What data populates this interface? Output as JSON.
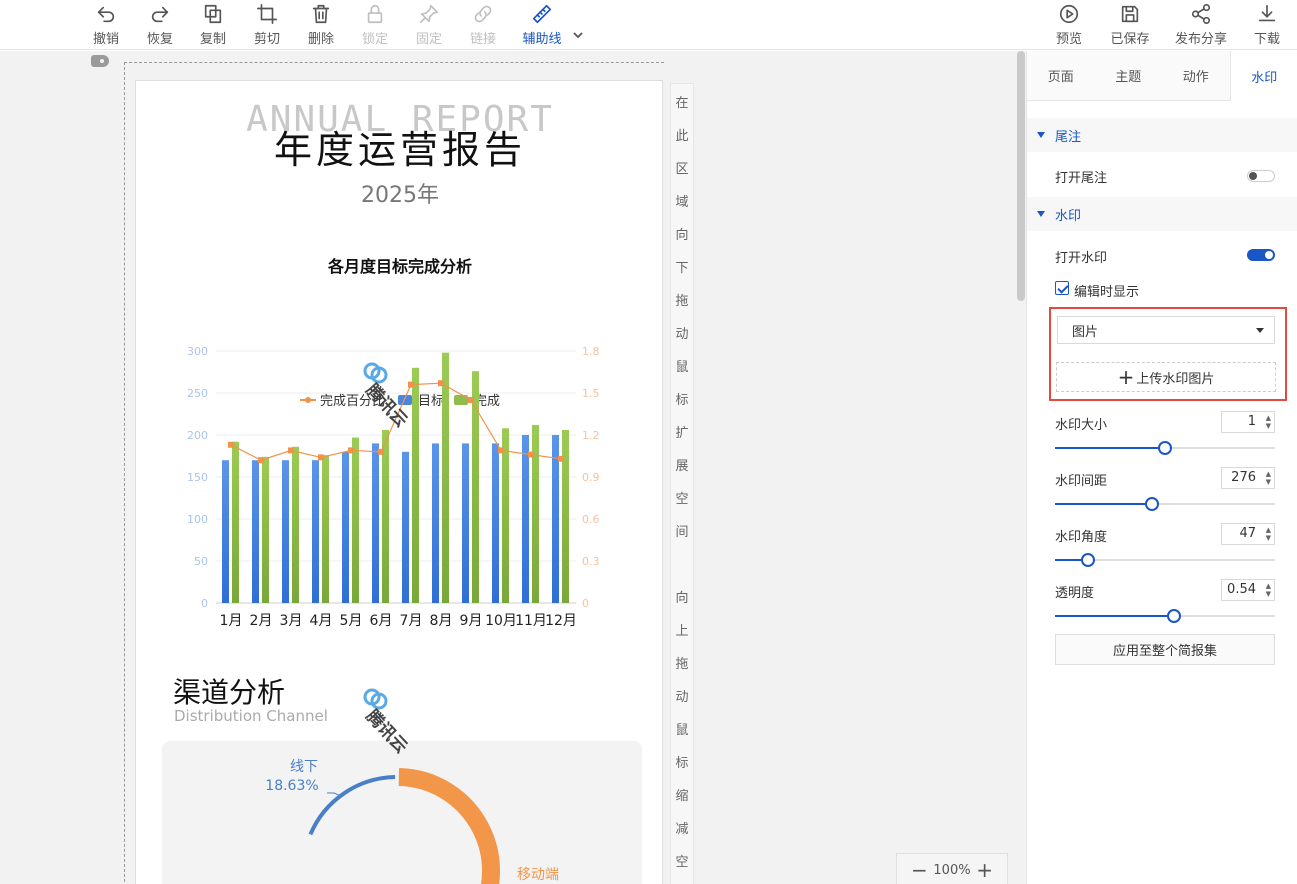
{
  "toolbar": {
    "left": [
      {
        "label": "撤销",
        "icon": "undo-icon",
        "state": "normal"
      },
      {
        "label": "恢复",
        "icon": "redo-icon",
        "state": "normal"
      },
      {
        "label": "复制",
        "icon": "copy-icon",
        "state": "normal"
      },
      {
        "label": "剪切",
        "icon": "crop-icon",
        "state": "normal"
      },
      {
        "label": "删除",
        "icon": "trash-icon",
        "state": "normal"
      },
      {
        "label": "锁定",
        "icon": "lock-icon",
        "state": "disabled"
      },
      {
        "label": "固定",
        "icon": "pin-icon",
        "state": "disabled"
      },
      {
        "label": "链接",
        "icon": "link-icon",
        "state": "disabled"
      },
      {
        "label": "辅助线",
        "icon": "ruler-icon",
        "state": "active"
      }
    ],
    "right": [
      {
        "label": "预览",
        "icon": "play-icon"
      },
      {
        "label": "已保存",
        "icon": "save-icon"
      },
      {
        "label": "发布分享",
        "icon": "share-icon"
      },
      {
        "label": "下载",
        "icon": "download-icon"
      }
    ]
  },
  "report": {
    "annual_text": "ANNUAL REPORT",
    "title": "年度运营报告",
    "year": "2025年",
    "chart_title": "各月度目标完成分析",
    "section_title": "渠道分析",
    "section_subtitle": "Distribution Channel",
    "watermark_text": "腾讯云"
  },
  "chart_data": [
    {
      "type": "bar",
      "title": "各月度目标完成分析",
      "categories": [
        "1月",
        "2月",
        "3月",
        "4月",
        "5月",
        "6月",
        "7月",
        "8月",
        "9月",
        "10月",
        "11月",
        "12月"
      ],
      "legend": [
        "完成百分比",
        "目标",
        "完成"
      ],
      "series": [
        {
          "name": "目标",
          "type": "bar",
          "axis": "left",
          "values": [
            170,
            170,
            170,
            170,
            180,
            190,
            180,
            190,
            190,
            190,
            200,
            200
          ]
        },
        {
          "name": "完成",
          "type": "bar",
          "axis": "left",
          "values": [
            192,
            174,
            186,
            176,
            197,
            206,
            280,
            298,
            276,
            208,
            212,
            206
          ]
        },
        {
          "name": "完成百分比",
          "type": "line",
          "axis": "right",
          "values": [
            1.13,
            1.02,
            1.09,
            1.04,
            1.09,
            1.08,
            1.56,
            1.57,
            1.45,
            1.09,
            1.06,
            1.03
          ]
        }
      ],
      "yleft_ticks": [
        "0",
        "50",
        "100",
        "150",
        "200",
        "250",
        "300"
      ],
      "yright_ticks": [
        "0",
        "0.3",
        "0.6",
        "0.9",
        "1.2",
        "1.5",
        "1.8"
      ],
      "ylim_left": [
        0,
        300
      ],
      "ylim_right": [
        0,
        1.8
      ],
      "colors": {
        "target": "#4a86e0",
        "done": "#8fbc4a",
        "pct": "#f2924a"
      }
    },
    {
      "type": "pie",
      "slices": [
        {
          "label": "线下",
          "value": 18.63,
          "value_text": "18.63%",
          "color": "#4a7fc8"
        },
        {
          "label": "移动端",
          "color": "#f2964a"
        }
      ]
    }
  ],
  "side_hint": {
    "down_chars": [
      "在",
      "此",
      "区",
      "域",
      "向",
      "下",
      "拖",
      "动",
      "鼠",
      "标",
      "扩",
      "展",
      "空",
      "间"
    ],
    "up_chars": [
      "向",
      "上",
      "拖",
      "动",
      "鼠",
      "标",
      "缩",
      "减",
      "空"
    ]
  },
  "zoom": {
    "value": "100%",
    "minus": "−",
    "plus": "+"
  },
  "panel": {
    "tabs": [
      "页面",
      "主题",
      "动作",
      "水印"
    ],
    "active_tab": "水印",
    "footnote_section": "尾注",
    "footnote_toggle_label": "打开尾注",
    "footnote_on": false,
    "watermark_section": "水印",
    "watermark_toggle_label": "打开水印",
    "watermark_on": true,
    "show_when_editing_label": "编辑时显示",
    "show_when_editing": true,
    "type_select": "图片",
    "upload_label": "上传水印图片",
    "controls": [
      {
        "label": "水印大小",
        "value": "1",
        "level": 0.5
      },
      {
        "label": "水印间距",
        "value": "276",
        "level": 0.44
      },
      {
        "label": "水印角度",
        "value": "47",
        "level": 0.15
      },
      {
        "label": "透明度",
        "value": "0.54",
        "level": 0.54
      }
    ],
    "apply_label": "应用至整个简报集"
  }
}
